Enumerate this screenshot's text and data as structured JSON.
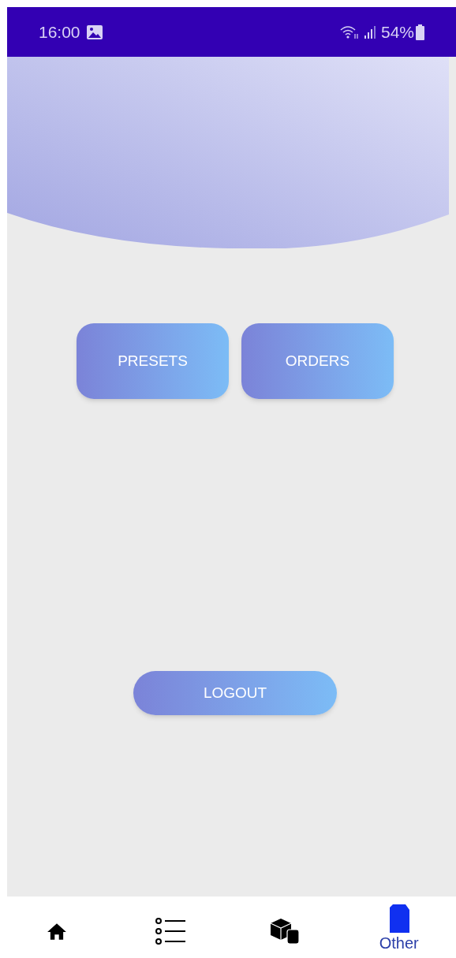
{
  "status_bar": {
    "time": "16:00",
    "battery": "54%"
  },
  "buttons": [
    {
      "label": "PRESETS"
    },
    {
      "label": "ORDERS"
    }
  ],
  "logout": {
    "label": "LOGOUT"
  },
  "nav": [
    {
      "kind": "home",
      "selected": false
    },
    {
      "kind": "list",
      "selected": false
    },
    {
      "kind": "boxes",
      "selected": false
    },
    {
      "kind": "other",
      "label": "Other",
      "selected": true
    }
  ]
}
